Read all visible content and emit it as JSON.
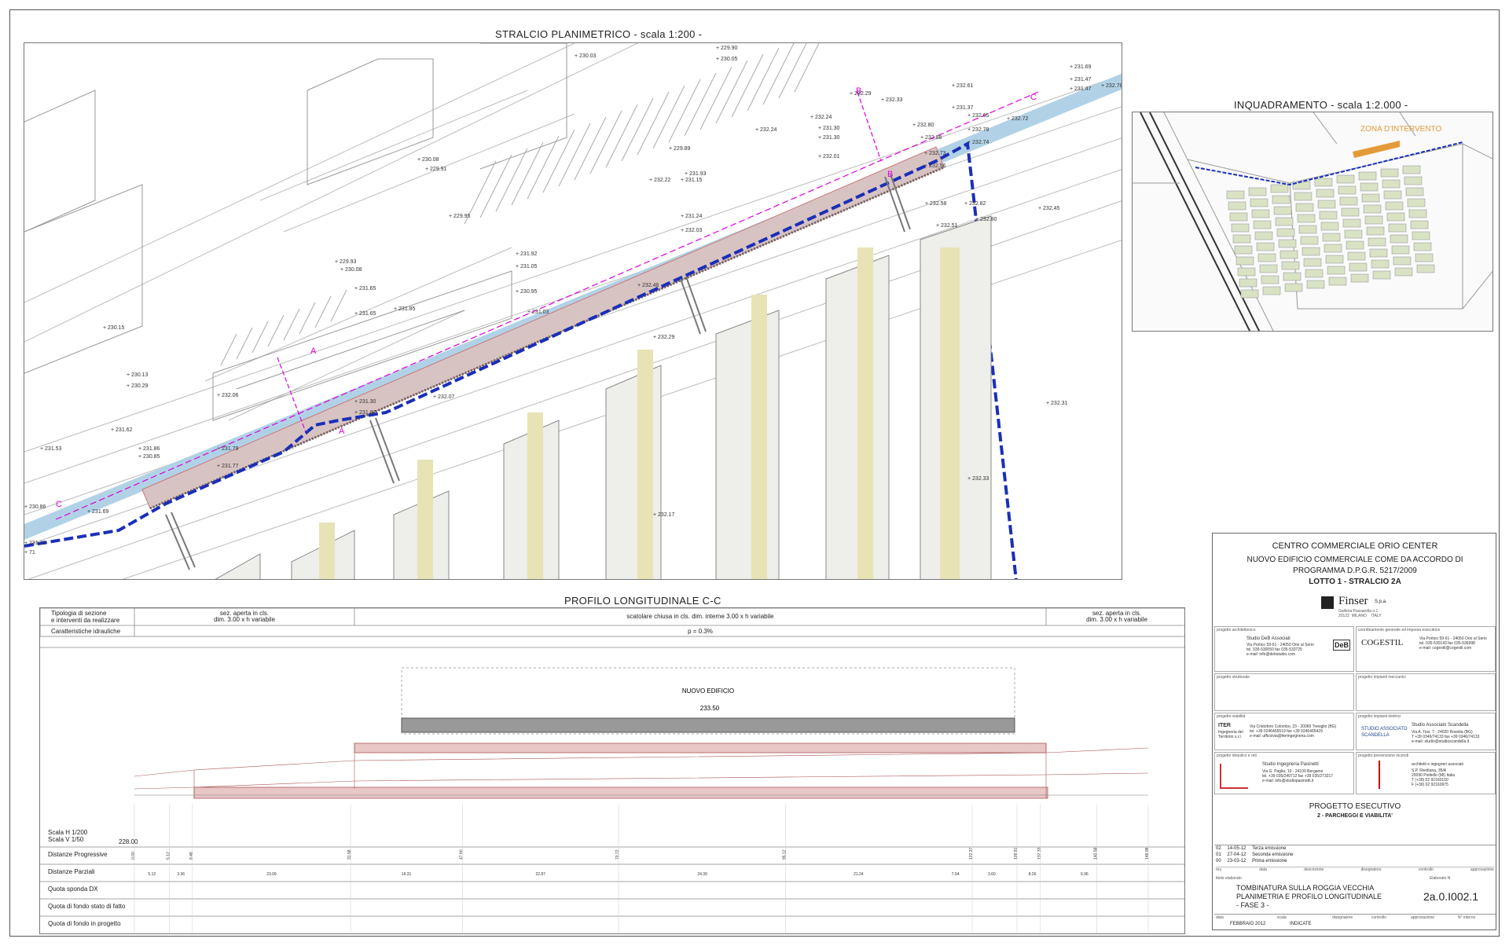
{
  "plan": {
    "title": "STRALCIO  PLANIMETRICO - scala 1:200 -",
    "section_marks": [
      "A",
      "A",
      "B",
      "B",
      "C",
      "C"
    ],
    "spot_levels": [
      "230.03",
      "229.90",
      "230.05",
      "231.69",
      "231.47",
      "231.47",
      "232.78",
      "232.61",
      "232.29",
      "232.33",
      "231.37",
      "232.65",
      "232.72",
      "232.24",
      "231.30",
      "232.80",
      "232.24",
      "231.30",
      "232.78",
      "232.88",
      "232.74",
      "229.89",
      "232.01",
      "232.73",
      "232.56",
      "230.08",
      "229.91",
      "231.93",
      "232.22",
      "231.15",
      "232.58",
      "232.82",
      "232.45",
      "229.95",
      "231.24",
      "232.03",
      "232.80",
      "232.51",
      "231.92",
      "231.05",
      "229.93",
      "230.08",
      "230.95",
      "232.46",
      "231.65",
      "231.85",
      "231.65",
      "231.03",
      "232.29",
      "230.15",
      "230.13",
      "230.29",
      "232.06",
      "231.30",
      "232.07",
      "231.87",
      "232.31",
      "231.62",
      "231.86",
      "231.53",
      "230.85",
      "231.79",
      "231.77",
      "232.33",
      "230.86",
      "231.69",
      "232.17",
      "231.71",
      "71"
    ]
  },
  "inquadramento": {
    "title": "INQUADRAMENTO - scala 1:2.000 -",
    "zone_label": "ZONA D'INTERVENTO"
  },
  "profile": {
    "title": "PROFILO LONGITUDINALE  C-C",
    "header_label_1": "Tipologia di sezione\ne interventi da realizzare",
    "header_label_2": "Caratteristiche idrauliche",
    "section_left": "sez. aperta in cls.\ndim. 3.00 x h variabile",
    "section_center": "scatolare chiusa in cls. dim. interne 3.00 x h variabile",
    "section_right": "sez. aperta in cls.\ndim. 3.00 x h variabile",
    "slope": "p = 0.3%",
    "building_label": "NUOVO EDIFICIO",
    "building_level": "233.50",
    "scale_h": "Scala H 1/200",
    "scale_v": "Scala V 1/50",
    "datum": "228.00",
    "rows": [
      "Distanze Progressive",
      "Distanze Parziali",
      "Quota sponda DX",
      "Quota di fondo stato di fatto",
      "Quota di fondo in progetto"
    ],
    "progressive": [
      "0.00",
      "5.12",
      "8.48",
      "31.58",
      "47.90",
      "70.72",
      "95.12",
      "122.37",
      "128.91",
      "132.33",
      "140.58",
      "148.08"
    ],
    "partial": [
      "5.12",
      "3.36",
      "23.09",
      "16.31",
      "22.87",
      "24.39",
      "21.24",
      "7.04",
      "3.60",
      "8.26",
      "6.96"
    ]
  },
  "title_block": {
    "project": "CENTRO COMMERCIALE ORIO CENTER",
    "subject_1": "NUOVO EDIFICIO COMMERCIALE COME DA ACCORDO DI",
    "subject_2": "PROGRAMMA D.P.G.R. 5217/2009",
    "lot": "LOTTO 1 - STRALCIO 2A",
    "client": "Finser",
    "client_suffix": "S.p.a.",
    "client_sub": "Galleria Passarella n.1\n20122  MILANO    ITALY",
    "arch_label": "progetto architettonico",
    "arch_name": "Studio DeB Associati",
    "arch_addr": "Via Portico 59-61 - 24050 Orio al Serio\ntel. 035-530050 fax 035-533725\ne-mail: info@debstudio.com",
    "arch_logo": "DeB",
    "coord_label": "coordinamento generale ed impresa esecutrice",
    "coord_logo": "COGESTIL",
    "coord_addr": "Via Portico 59-61 - 24050 Orio al Serio\ntel. 035-530143 fax 035-536998\ne-mail: cogestil@cogestil.com",
    "struct_label": "progetto strutturale",
    "mech_label": "progetto impianti meccanici",
    "road_label": "progetto viabilità",
    "road_logo": "ITER",
    "road_logo_sub": "Ingegneria del\nTerritorio s.r.l.",
    "road_addr": "Via Cristoforo Colombo, 23 - 20060 Treviglio (BG)\ntel. +39 0246465519 fax +39 0246465429\ne-mail: ufficiovia@iteringegneria.com",
    "elec_label": "progetto impianti elettrici",
    "elec_logo": "STUDIO ASSOCIATO\nSCANDELLA",
    "elec_name": "Studio Associato Scandella",
    "elec_addr": "Via A. Tosi, 7 - 24020 Rovetta (BG)\nT +39 0346/74133 fax +39 0346/74133\ne-mail: studio@studioscandella.it",
    "hyd_label": "progetto idraulico e reti",
    "hyd_name": "Studio Ingegneria Pasinetti",
    "hyd_addr": "Via G. Paglia, 10 - 24100 Bergamo\ntel. +39 035/240712 fax +39 035/273217\ne-mail: info@studiopasinetti.it",
    "fire_label": "progetto prevenzione incendi",
    "fire_name": "architetti e ingegneri associati",
    "fire_addr": "S.P. Rivoltana, 35/A\n20090 Pioltello (MI) Italia\nT (+39) 02 92160150\nF (+39) 02 92160975",
    "phase": "PROGETTO      ESECUTIVO",
    "phase_sub": "2 - PARCHEGGI E VIABILITA'",
    "revisions": [
      {
        "n": "02",
        "date": "14-05-12",
        "desc": "Terza emissione"
      },
      {
        "n": "01",
        "date": "27-04-12",
        "desc": "Seconda emissione"
      },
      {
        "n": "00",
        "date": "23-03-12",
        "desc": "Prima emissione"
      }
    ],
    "rev_headers": [
      "rev.",
      "data",
      "descrizione",
      "disegnatore",
      "controllo",
      "approvazione"
    ],
    "drawing_title_1": "TOMBINATURA SULLA ROGGIA VECCHIA",
    "drawing_title_2": "PLANIMETRIA E PROFILO LONGITUDINALE",
    "drawing_title_3": "- FASE 3 -",
    "drawing_label": "titolo elaborato",
    "drawing_no_label": "Elaborato N.",
    "drawing_no": "2a.0.I002.1",
    "date_label": "data",
    "date": "FEBBRAIO 2012",
    "scale_label": "scala",
    "scale": "INDICATE",
    "drawer_label": "disegnatore",
    "control_label": "controllo",
    "approval_label": "approvazione",
    "internal_label": "N° interno"
  }
}
